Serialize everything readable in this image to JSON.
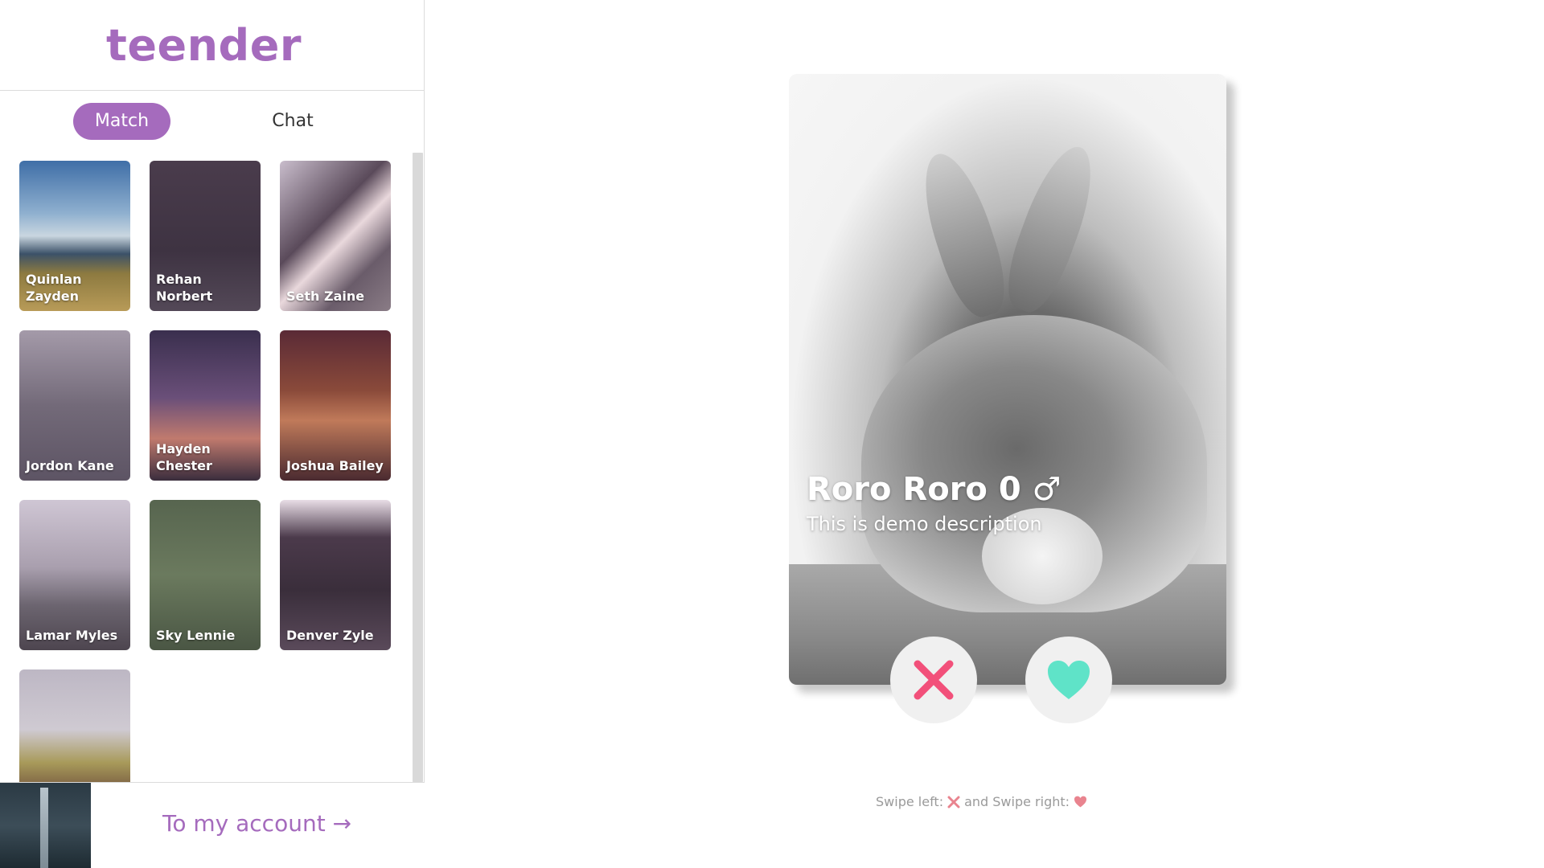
{
  "app": {
    "logo": "teender"
  },
  "tabs": [
    {
      "label": "Match",
      "active": true
    },
    {
      "label": "Chat",
      "active": false
    }
  ],
  "matches": [
    {
      "name": "Quinlan Zayden"
    },
    {
      "name": "Rehan Norbert"
    },
    {
      "name": "Seth Zaine"
    },
    {
      "name": "Jordon Kane"
    },
    {
      "name": "Hayden Chester"
    },
    {
      "name": "Joshua Bailey"
    },
    {
      "name": "Lamar Myles"
    },
    {
      "name": "Sky Lennie"
    },
    {
      "name": "Denver Zyle"
    },
    {
      "name": ""
    }
  ],
  "account": {
    "link_label": "To my account →"
  },
  "profile": {
    "name": "Roro Roro 0 ♂",
    "description": "This is demo description"
  },
  "actions": {
    "nope_icon": "close-icon",
    "like_icon": "heart-icon"
  },
  "hint": {
    "prefix": "Swipe left:",
    "middle": "and Swipe right:"
  },
  "colors": {
    "accent": "#a56bbd",
    "nope": "#f2507a",
    "like": "#5fe3c8"
  }
}
